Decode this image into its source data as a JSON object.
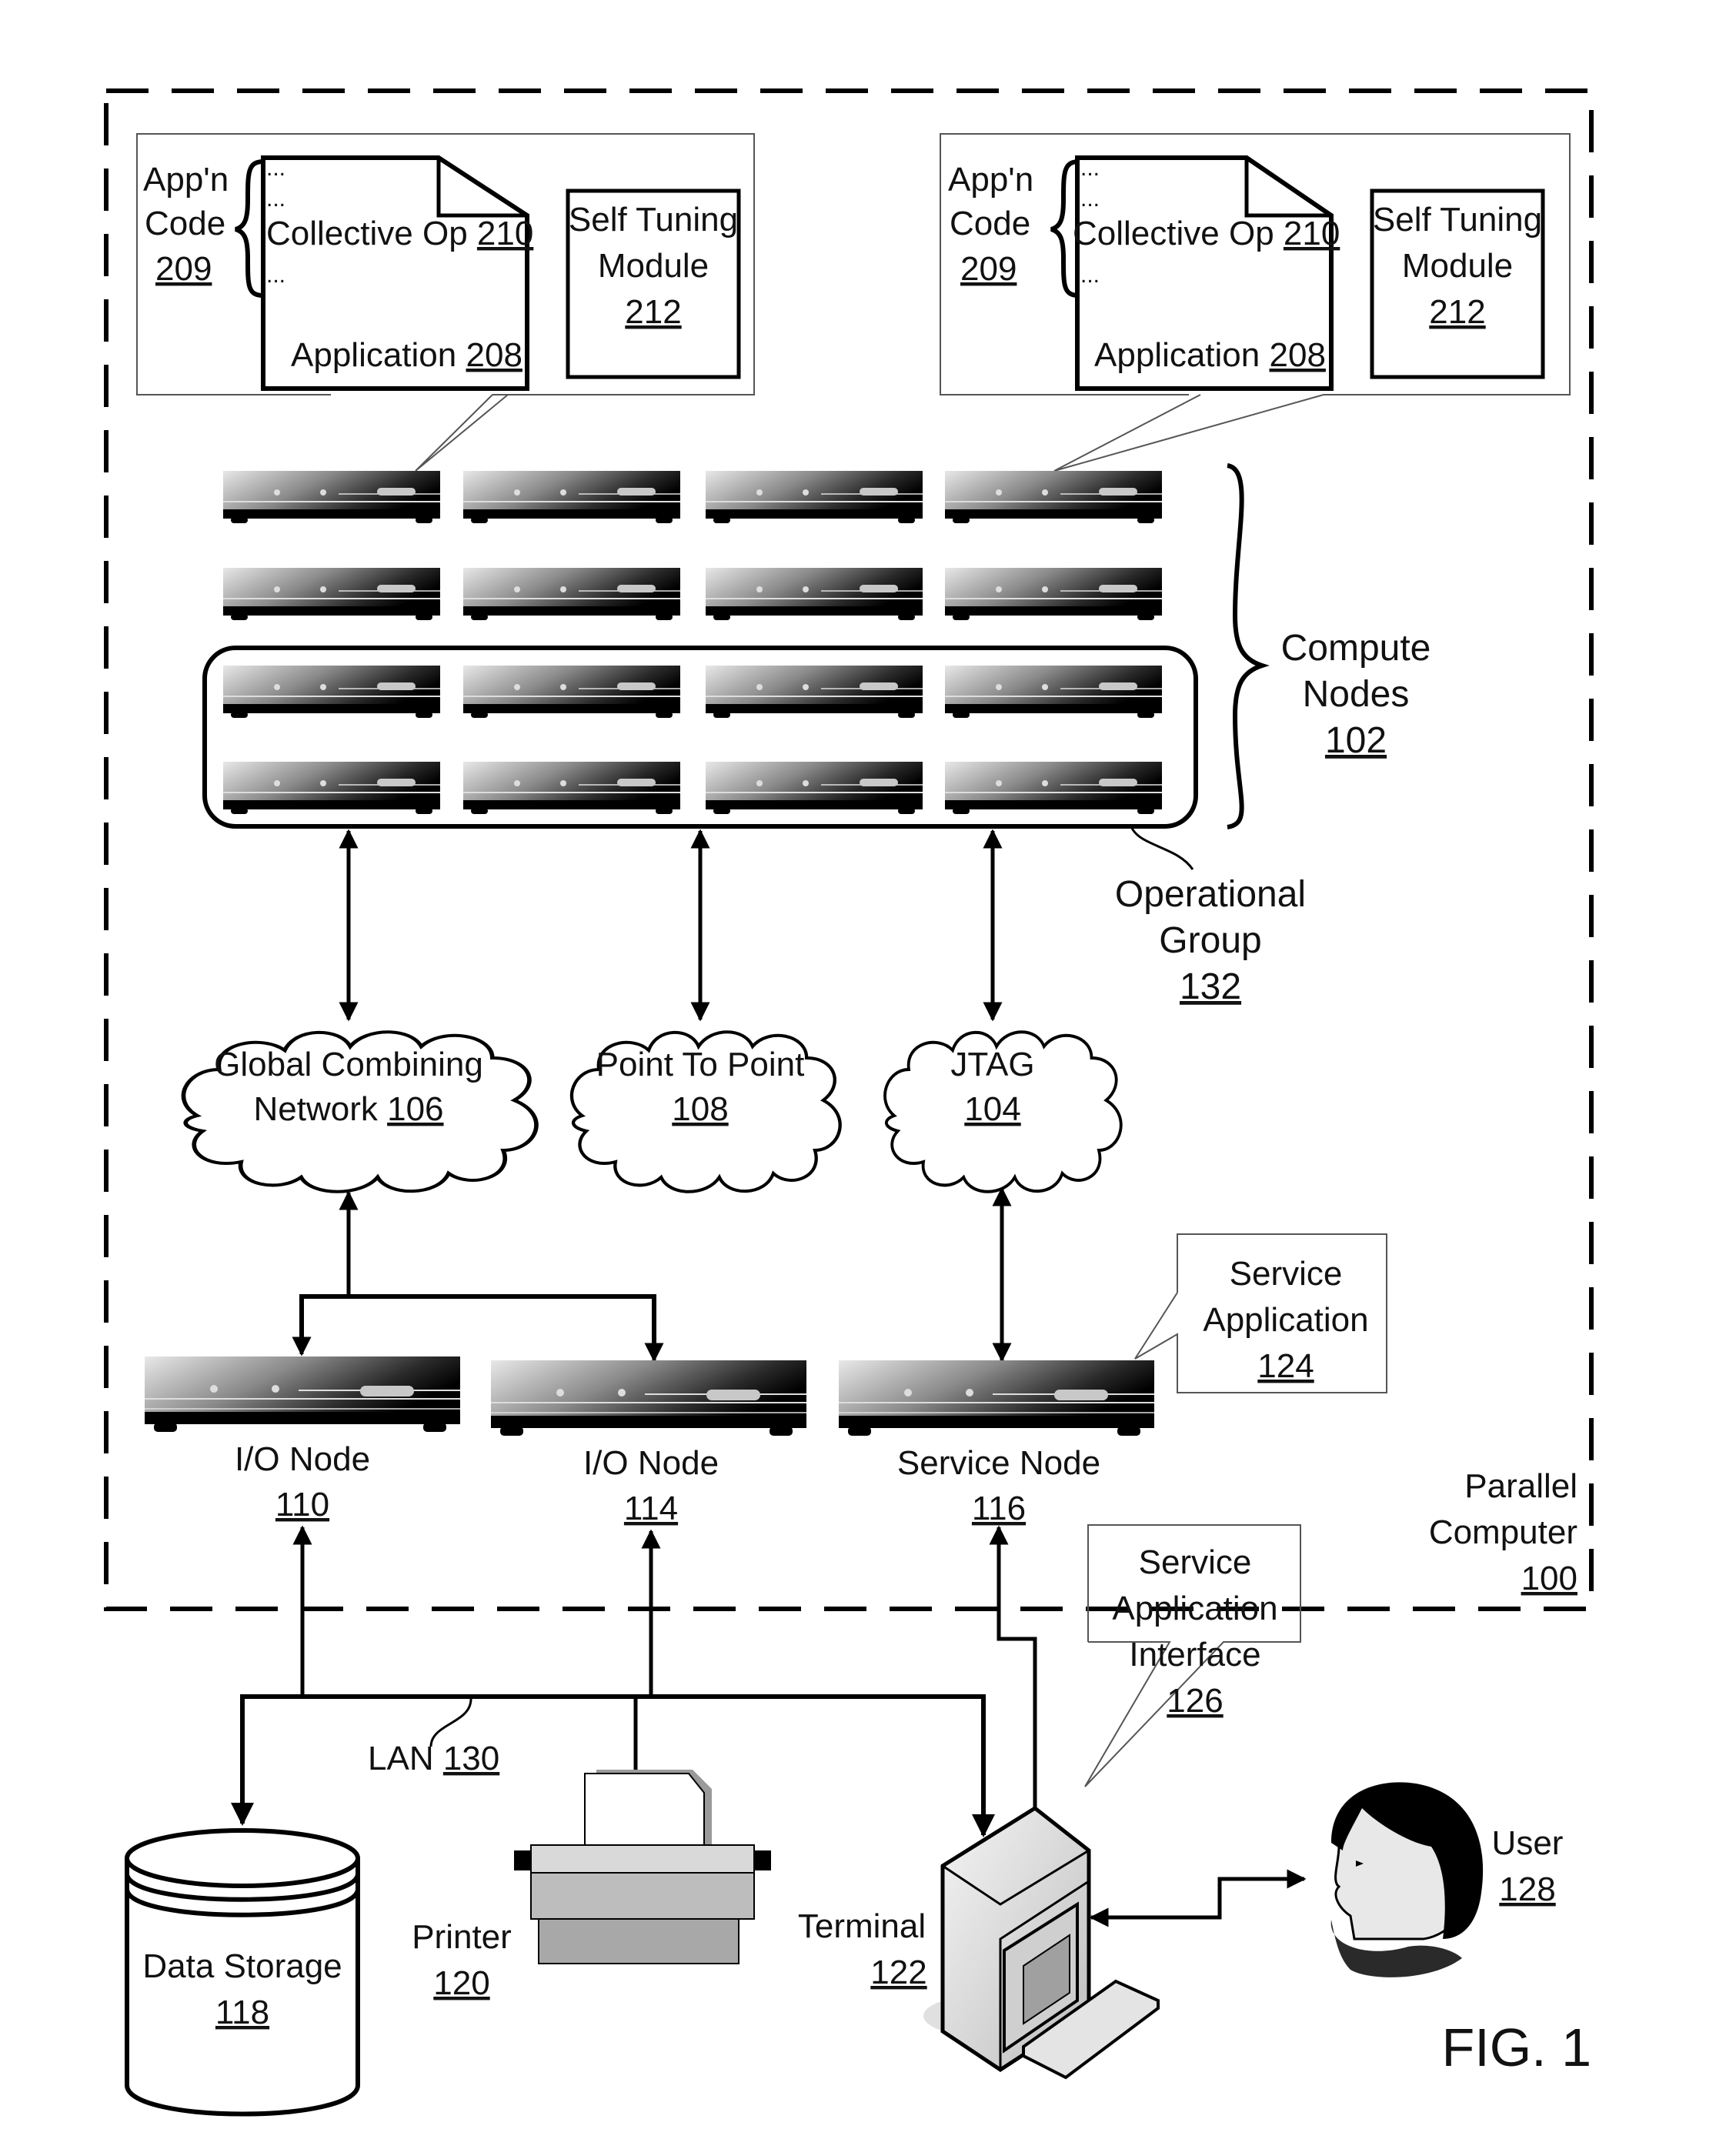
{
  "figure": {
    "label": "FIG. 1",
    "parallel_computer": {
      "line1": "Parallel",
      "line2": "Computer",
      "ref": "100"
    }
  },
  "app_panels": [
    {
      "appn_code": {
        "line1": "App'n",
        "line2": "Code",
        "ref": "209"
      },
      "ellipsis": "...",
      "collective_op": {
        "label": "Collective Op",
        "ref": "210"
      },
      "application": {
        "label": "Application",
        "ref": "208"
      },
      "self_tuning": {
        "line1": "Self Tuning",
        "line2": "Module",
        "ref": "212"
      }
    },
    {
      "appn_code": {
        "line1": "App'n",
        "line2": "Code",
        "ref": "209"
      },
      "ellipsis": "...",
      "collective_op": {
        "label": "Collective Op",
        "ref": "210"
      },
      "application": {
        "label": "Application",
        "ref": "208"
      },
      "self_tuning": {
        "line1": "Self Tuning",
        "line2": "Module",
        "ref": "212"
      }
    }
  ],
  "compute_nodes": {
    "line1": "Compute",
    "line2": "Nodes",
    "ref": "102",
    "rows": 4,
    "cols": 4
  },
  "operational_group": {
    "line1": "Operational",
    "line2": "Group",
    "ref": "132"
  },
  "networks": [
    {
      "line1": "Global Combining",
      "line2": "Network",
      "ref": "106"
    },
    {
      "line1": "Point To Point",
      "line2": "",
      "ref": "108"
    },
    {
      "line1": "JTAG",
      "line2": "",
      "ref": "104"
    }
  ],
  "io_nodes": [
    {
      "label": "I/O Node",
      "ref": "110"
    },
    {
      "label": "I/O Node",
      "ref": "114"
    }
  ],
  "service_node": {
    "label": "Service Node",
    "ref": "116"
  },
  "service_application": {
    "line1": "Service",
    "line2": "Application",
    "ref": "124"
  },
  "service_app_interface": {
    "line1": "Service",
    "line2": "Application",
    "line3": "Interface",
    "ref": "126"
  },
  "lan": {
    "label": "LAN",
    "ref": "130"
  },
  "data_storage": {
    "label": "Data Storage",
    "ref": "118"
  },
  "printer": {
    "label": "Printer",
    "ref": "120"
  },
  "terminal": {
    "label": "Terminal",
    "ref": "122"
  },
  "user": {
    "label": "User",
    "ref": "128"
  }
}
